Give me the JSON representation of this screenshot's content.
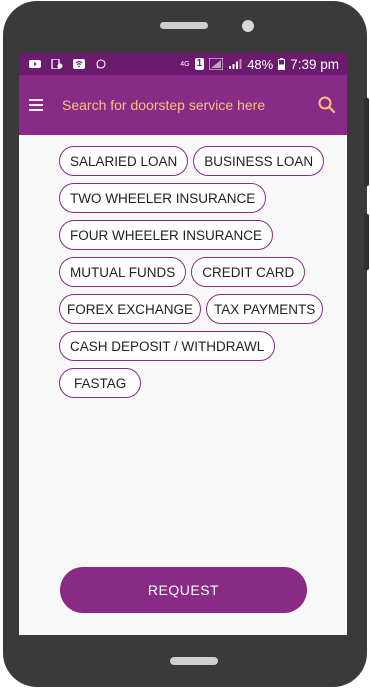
{
  "status_bar": {
    "network": "4G",
    "sim": "1",
    "battery": "48%",
    "time": "7:39 pm",
    "icons": [
      "youtube-icon",
      "file-icon",
      "wifi-icon",
      "whatsapp-icon",
      "signal-icon",
      "battery-icon"
    ]
  },
  "app_bar": {
    "search_placeholder": "Search for doorstep service here",
    "menu_icon": "menu-icon",
    "search_icon": "search-icon"
  },
  "services": [
    "SALARIED LOAN",
    "BUSINESS LOAN",
    "TWO WHEELER INSURANCE",
    "FOUR WHEELER INSURANCE",
    "MUTUAL FUNDS",
    "CREDIT CARD",
    "FOREX EXCHANGE",
    "TAX PAYMENTS",
    "CASH DEPOSIT / WITHDRAWL",
    "FASTAG"
  ],
  "request_label": "REQUEST",
  "colors": {
    "primary": "#882a86",
    "status_bar": "#6b1b6e",
    "accent": "#f6c47d",
    "chip_border": "#8a2a88"
  }
}
